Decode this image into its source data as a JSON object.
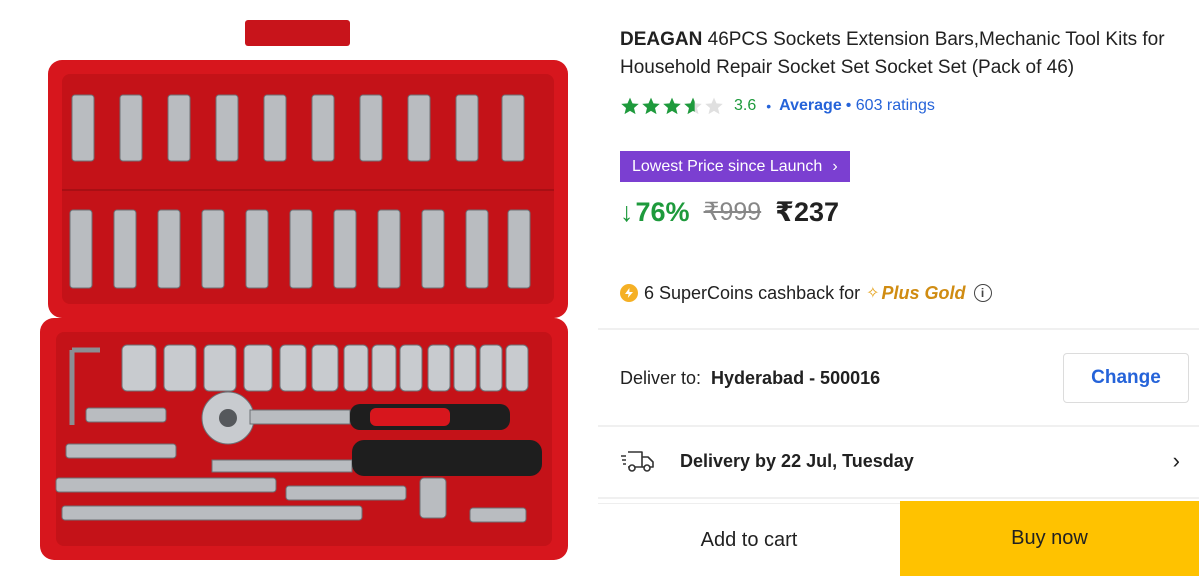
{
  "product": {
    "brand": "DEAGAN",
    "title": "46PCS Sockets Extension Bars,Mechanic Tool Kits for Household Repair Socket Set Socket Set (Pack of 46)",
    "image_icon": "socket-set-toolbox"
  },
  "rating": {
    "value": "3.6",
    "stars_filled": 3.6,
    "stars_total": 5,
    "separator": "•",
    "label": "Average",
    "count": "• 603 ratings",
    "star_color": "#1e9a3c"
  },
  "offer_badge": {
    "label": "Lowest Price since Launch",
    "chevron": "›",
    "color": "#7b3fd1"
  },
  "price": {
    "arrow": "↓",
    "discount": "76%",
    "mrp": "₹999",
    "final": "₹237",
    "discount_color": "#1e9a3c"
  },
  "supercoins": {
    "text": "6 SuperCoins cashback for",
    "plus_icon": "✧",
    "program": "Plus Gold",
    "info_icon": "i"
  },
  "delivery": {
    "deliver_to_label": "Deliver to:",
    "location": "Hyderabad - 500016",
    "change_label": "Change",
    "date_text": "Delivery by 22 Jul, Tuesday",
    "chevron": "›"
  },
  "actions": {
    "add_to_cart": "Add to cart",
    "buy_now": "Buy now",
    "buy_color": "#ffc200"
  }
}
